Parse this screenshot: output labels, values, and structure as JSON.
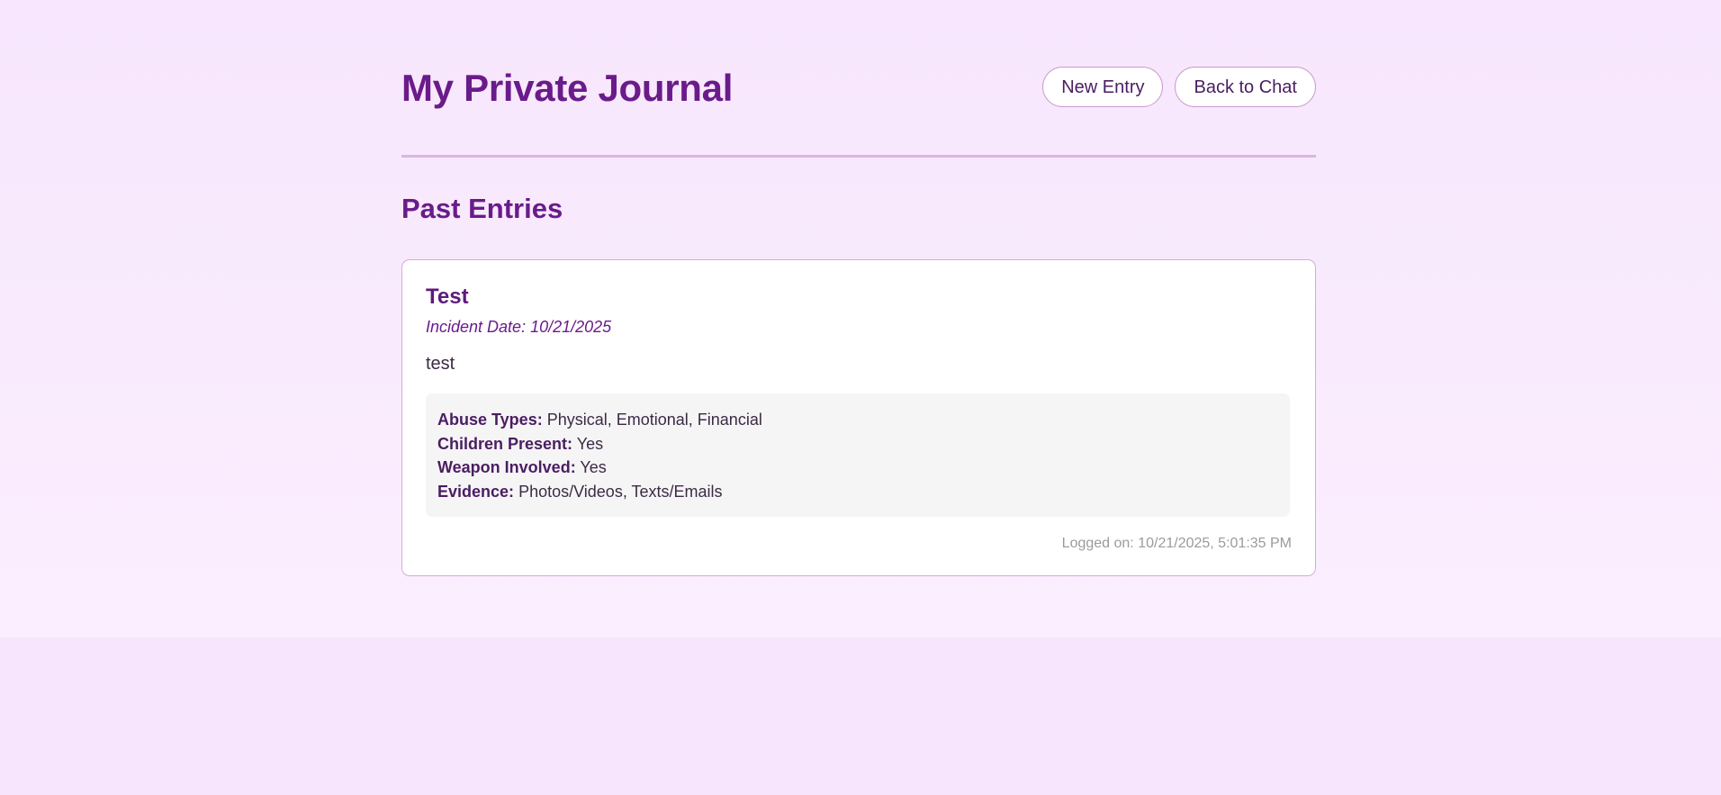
{
  "header": {
    "title": "My Private Journal",
    "new_entry_label": "New Entry",
    "back_to_chat_label": "Back to Chat"
  },
  "past_entries": {
    "title": "Past Entries",
    "entries": [
      {
        "title": "Test",
        "incident_date_label": "Incident Date:",
        "incident_date": "10/21/2025",
        "body": "test",
        "details": {
          "abuse_types_label": "Abuse Types:",
          "abuse_types": "Physical, Emotional, Financial",
          "children_present_label": "Children Present:",
          "children_present": "Yes",
          "weapon_involved_label": "Weapon Involved:",
          "weapon_involved": "Yes",
          "evidence_label": "Evidence:",
          "evidence": "Photos/Videos, Texts/Emails"
        },
        "logged_on_label": "Logged on:",
        "logged_on": "10/21/2025, 5:01:35 PM"
      }
    ]
  },
  "colors": {
    "accent": "#6a1b8a",
    "background": "#f6e5fd",
    "card": "#ffffff",
    "details_bg": "#f6f5f6"
  }
}
